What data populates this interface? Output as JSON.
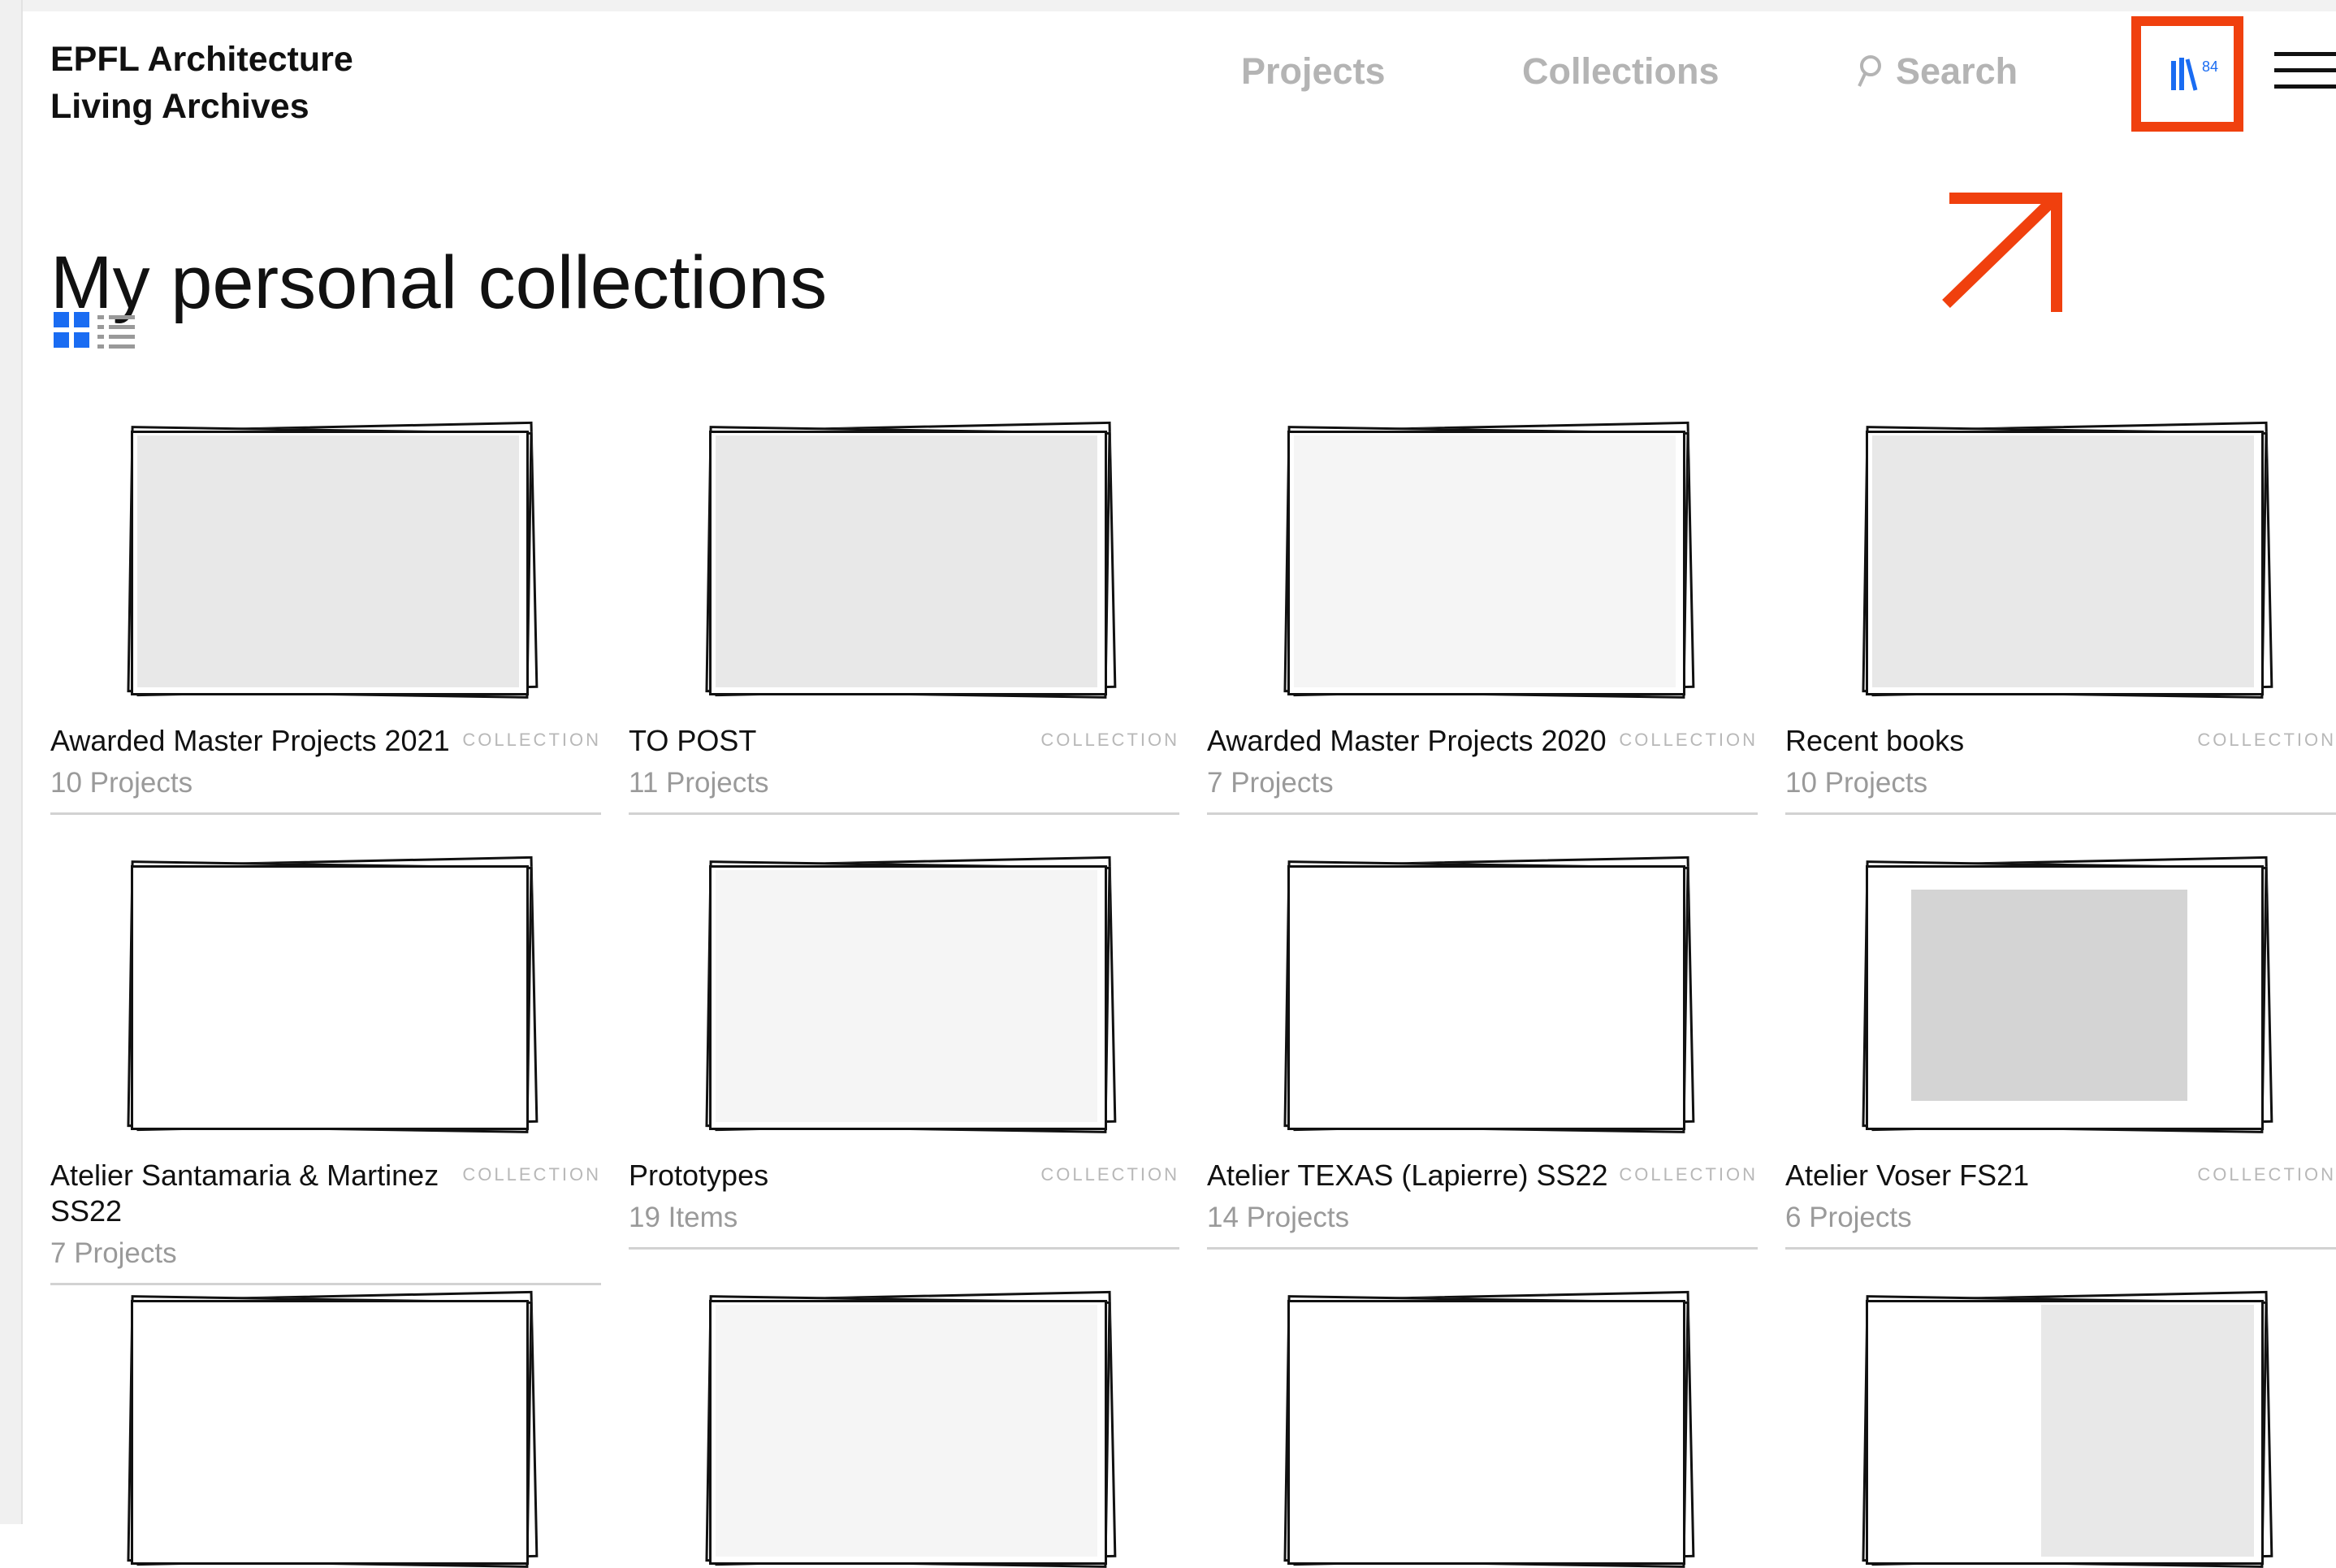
{
  "header": {
    "brand_line1": "EPFL Architecture",
    "brand_line2": "Living Archives",
    "nav": {
      "projects": "Projects",
      "collections": "Collections",
      "search": "Search"
    },
    "collections_count": "84",
    "highlight_color": "#f0400e",
    "accent_color": "#1a6cf2"
  },
  "main": {
    "title": "My personal collections",
    "view_toggle": {
      "grid": "grid-view-icon",
      "list": "list-view-icon"
    },
    "cards": [
      {
        "title": "Awarded Master Projects 2021",
        "type": "COLLECTION",
        "count": "10 Projects"
      },
      {
        "title": "TO POST",
        "type": "COLLECTION",
        "count": "11 Projects"
      },
      {
        "title": "Awarded Master Projects 2020",
        "type": "COLLECTION",
        "count": "7 Projects"
      },
      {
        "title": "Recent books",
        "type": "COLLECTION",
        "count": "10 Projects"
      },
      {
        "title": "Atelier Santamaria & Martinez SS22",
        "type": "COLLECTION",
        "count": "7 Projects"
      },
      {
        "title": "Prototypes",
        "type": "COLLECTION",
        "count": "19 Items"
      },
      {
        "title": "Atelier TEXAS (Lapierre) SS22",
        "type": "COLLECTION",
        "count": "14 Projects"
      },
      {
        "title": "Atelier Voser FS21",
        "type": "COLLECTION",
        "count": "6 Projects"
      }
    ]
  }
}
